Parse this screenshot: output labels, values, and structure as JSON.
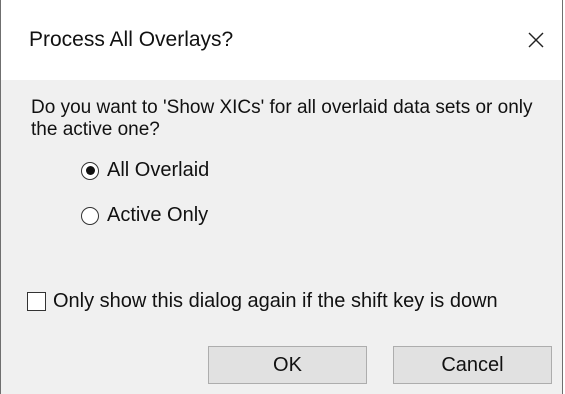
{
  "window": {
    "title": "Process All Overlays?",
    "close_icon": "close-icon"
  },
  "prompt": "Do you want to 'Show XICs' for all overlaid data sets or only the active one?",
  "options": [
    {
      "label": "All Overlaid",
      "selected": true
    },
    {
      "label": "Active Only",
      "selected": false
    }
  ],
  "checkbox": {
    "label": "Only show this dialog again if the shift key is down",
    "checked": false
  },
  "buttons": {
    "ok_label": "OK",
    "cancel_label": "Cancel"
  }
}
